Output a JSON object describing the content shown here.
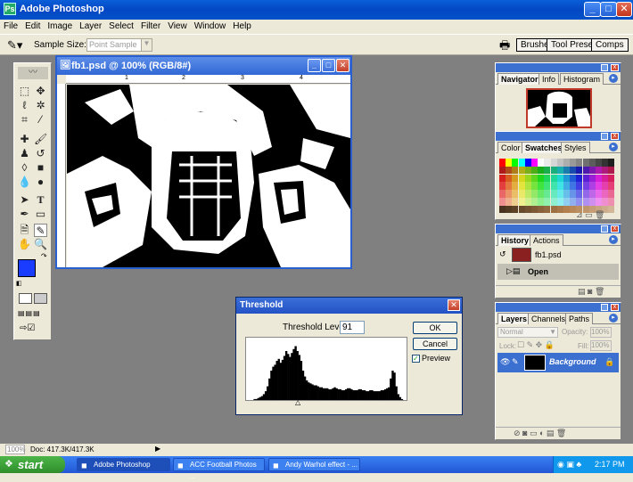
{
  "window": {
    "title": "Adobe Photoshop",
    "min": "_",
    "max": "□",
    "close": "✕"
  },
  "menu": [
    "File",
    "Edit",
    "Image",
    "Layer",
    "Select",
    "Filter",
    "View",
    "Window",
    "Help"
  ],
  "options": {
    "sample_size_label": "Sample Size:",
    "sample_size_value": "Point Sample",
    "well_tabs": [
      "Brushes",
      "Tool Presets",
      "Comps"
    ]
  },
  "document": {
    "title": "fb1.psd @ 100% (RGB/8#)",
    "ruler_marks": [
      "1",
      "2",
      "3",
      "4"
    ]
  },
  "navigator": {
    "tabs": [
      "Navigator",
      "Info",
      "Histogram"
    ]
  },
  "swatches": {
    "tabs": [
      "Color",
      "Swatches",
      "Styles"
    ]
  },
  "history": {
    "tabs": [
      "History",
      "Actions"
    ],
    "snapshot": "fb1.psd",
    "step": "Open"
  },
  "layers": {
    "tabs": [
      "Layers",
      "Channels",
      "Paths"
    ],
    "blend_mode": "Normal",
    "opacity_label": "Opacity:",
    "opacity": "100%",
    "lock_label": "Lock:",
    "fill_label": "Fill:",
    "fill": "100%",
    "layer_name": "Background"
  },
  "threshold": {
    "title": "Threshold",
    "level_label": "Threshold Level:",
    "level": "91",
    "ok": "OK",
    "cancel": "Cancel",
    "preview": "Preview",
    "histogram": [
      0,
      0,
      0,
      0,
      1,
      1,
      2,
      3,
      4,
      6,
      9,
      14,
      22,
      30,
      34,
      36,
      40,
      42,
      38,
      41,
      45,
      50,
      47,
      44,
      48,
      52,
      55,
      50,
      46,
      40,
      30,
      24,
      20,
      18,
      17,
      16,
      15,
      15,
      14,
      13,
      13,
      12,
      12,
      12,
      11,
      11,
      12,
      13,
      12,
      11,
      11,
      10,
      10,
      11,
      12,
      12,
      11,
      10,
      10,
      10,
      11,
      11,
      10,
      10,
      9,
      9,
      10,
      10,
      9,
      9,
      9,
      9,
      10,
      10,
      11,
      12,
      13,
      22,
      30,
      28,
      14,
      6,
      3,
      1,
      0,
      0
    ]
  },
  "status": {
    "zoom": "100%",
    "doc": "Doc: 417.3K/417.3K"
  },
  "taskbar": {
    "start": "start",
    "items": [
      "Adobe Photoshop",
      "ACC Football Photos ...",
      "Andy Warhol effect - ..."
    ],
    "clock": "2:17 PM"
  },
  "colors": {
    "foreground": "#1a3cff",
    "background": "#5ce05c",
    "accent": "#0a5fd8"
  }
}
